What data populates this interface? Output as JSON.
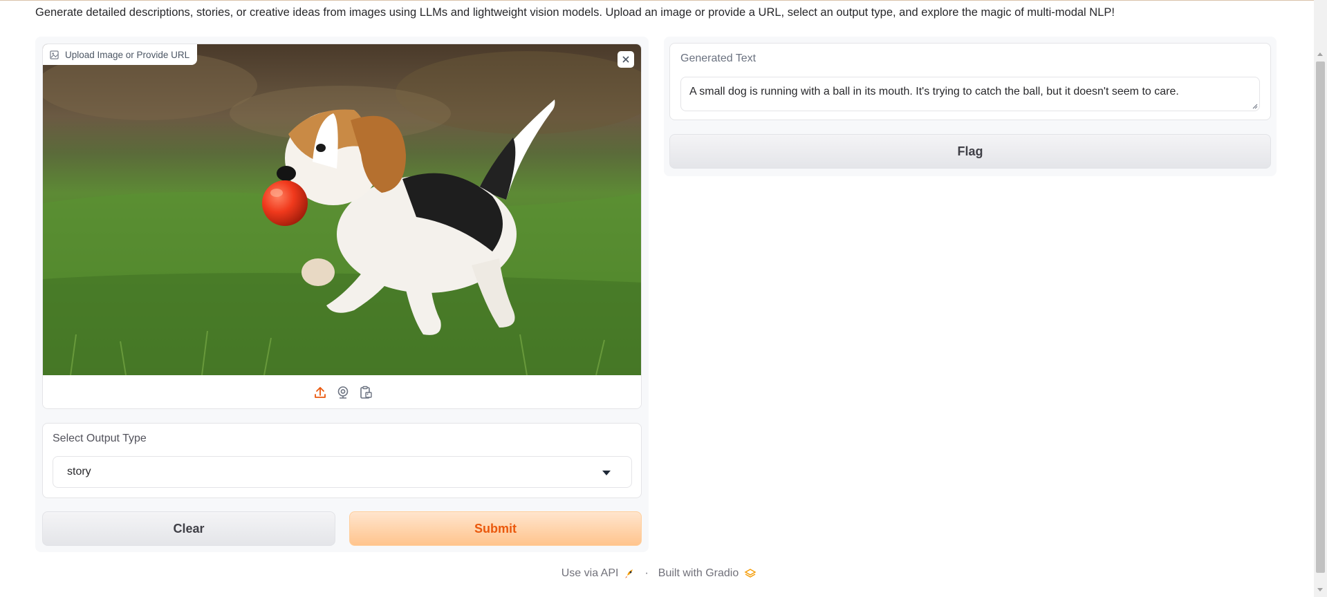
{
  "description": "Generate detailed descriptions, stories, or creative ideas from images using LLMs and lightweight vision models. Upload an image or provide a URL, select an output type, and explore the magic of multi-modal NLP!",
  "image_input": {
    "label": "Upload Image or Provide URL",
    "image_subject": "beagle puppy running on grass with a red ball in its mouth",
    "source_icons": [
      "upload-icon",
      "webcam-icon",
      "clipboard-icon"
    ]
  },
  "output_type": {
    "label": "Select Output Type",
    "selected": "story"
  },
  "buttons": {
    "clear": "Clear",
    "submit": "Submit",
    "flag": "Flag"
  },
  "output": {
    "label": "Generated Text",
    "value": "A small dog is running with a ball in its mouth. It's trying to catch the ball, but it doesn't seem to care."
  },
  "footer": {
    "api_link": "Use via API",
    "separator": "·",
    "built_with": "Built with Gradio"
  },
  "colors": {
    "accent": "#ea580c",
    "submit_bg": "#ffc48d",
    "panel_bg": "#f7f8fa"
  }
}
